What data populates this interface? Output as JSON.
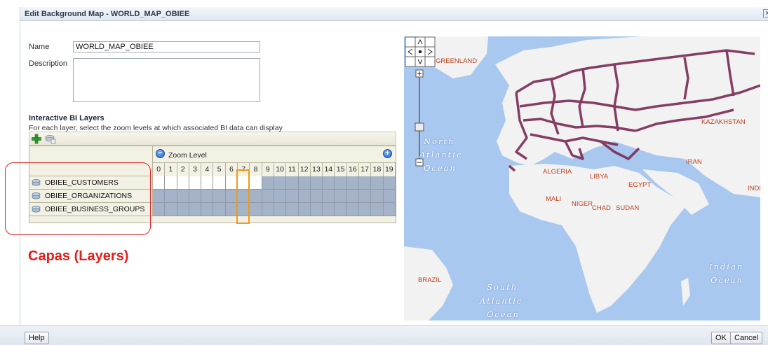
{
  "dialog": {
    "title": "Edit Background Map - WORLD_MAP_OBIEE",
    "close_glyph": "x"
  },
  "form": {
    "name_label": "Name",
    "name_value": "WORLD_MAP_OBIEE",
    "description_label": "Description",
    "description_value": ""
  },
  "layers_section": {
    "title": "Interactive BI Layers",
    "description": "For each layer, select the zoom levels at which associated BI data can display",
    "toolbar": {
      "add_icon": "add-plus-icon",
      "import_icon": "layers-import-icon"
    },
    "zoom_header": "Zoom Level",
    "zoom_levels": [
      "0",
      "1",
      "2",
      "3",
      "4",
      "5",
      "6",
      "7",
      "8",
      "9",
      "10",
      "11",
      "12",
      "13",
      "14",
      "15",
      "16",
      "17",
      "18",
      "19"
    ],
    "highlighted_zoom": 7,
    "layers": [
      {
        "name": "OBIEE_CUSTOMERS",
        "visible_from": 0,
        "visible_to": 8
      },
      {
        "name": "OBIEE_ORGANIZATIONS",
        "visible_from": 0,
        "visible_to": 0
      },
      {
        "name": "OBIEE_BUSINESS_GROUPS",
        "visible_from": 0,
        "visible_to": 0
      }
    ]
  },
  "annotation": {
    "text": "Capas (Layers)",
    "color": "#e0201c"
  },
  "map": {
    "labels": [
      "GREENLAND",
      "KAZAKHSTAN",
      "IRAN",
      "ALGERIA",
      "LIBYA",
      "EGYPT",
      "INDI",
      "MALI",
      "NIGER",
      "CHAD",
      "SUDAN",
      "BRAZIL"
    ],
    "oceans": {
      "north_atlantic": [
        "North",
        "Atlantic",
        "Ocean"
      ],
      "south_atlantic": [
        "South",
        "Atlantic",
        "Ocean"
      ],
      "indian": [
        "Indian",
        "Ocean"
      ]
    },
    "colors": {
      "water": "#a9c8f0",
      "land": "#f2f2f2",
      "borders": "#7a2a55"
    }
  },
  "footer": {
    "help": "Help",
    "ok": "OK",
    "cancel": "Cancel"
  }
}
